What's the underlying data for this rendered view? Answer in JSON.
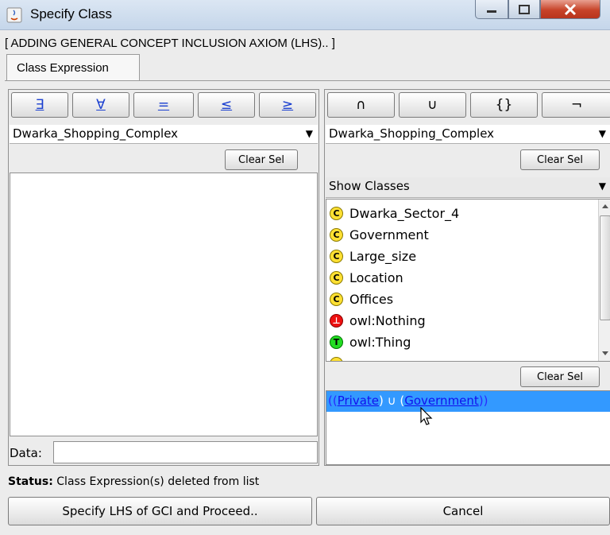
{
  "window": {
    "title": "Specify Class"
  },
  "header": {
    "text": "[ ADDING GENERAL CONCEPT INCLUSION AXIOM (LHS).. ]"
  },
  "tabs": [
    {
      "label": "Class Expression"
    }
  ],
  "left": {
    "operators": [
      "∃",
      "∀",
      "=",
      "≤",
      "≥"
    ],
    "combo_value": "Dwarka_Shopping_Complex",
    "clear_label": "Clear Sel",
    "data_label": "Data:",
    "data_value": ""
  },
  "right": {
    "operators": [
      "∩",
      "∪",
      "{}",
      "¬"
    ],
    "combo_value": "Dwarka_Shopping_Complex",
    "clear_label": "Clear Sel",
    "show_combo": "Show Classes",
    "classes": [
      {
        "icon": "C",
        "name": "Dwarka_Sector_4"
      },
      {
        "icon": "C",
        "name": "Government"
      },
      {
        "icon": "C",
        "name": "Large_size"
      },
      {
        "icon": "C",
        "name": "Location"
      },
      {
        "icon": "C",
        "name": "Offices"
      },
      {
        "icon": "⊥",
        "name": "owl:Nothing"
      },
      {
        "icon": "T",
        "name": "owl:Thing"
      }
    ],
    "clear2_label": "Clear Sel",
    "expression": {
      "open": "((",
      "first": "Private",
      "mid": ") ∪ (",
      "second": "Government",
      "close": "))"
    }
  },
  "status": {
    "label": "Status:",
    "text": " Class Expression(s) deleted from list"
  },
  "buttons": {
    "proceed": "Specify LHS of GCI and Proceed..",
    "cancel": "Cancel"
  },
  "colors": {
    "selection": "#3399ff",
    "link": "#1111ee",
    "close_button": "#c74329"
  }
}
